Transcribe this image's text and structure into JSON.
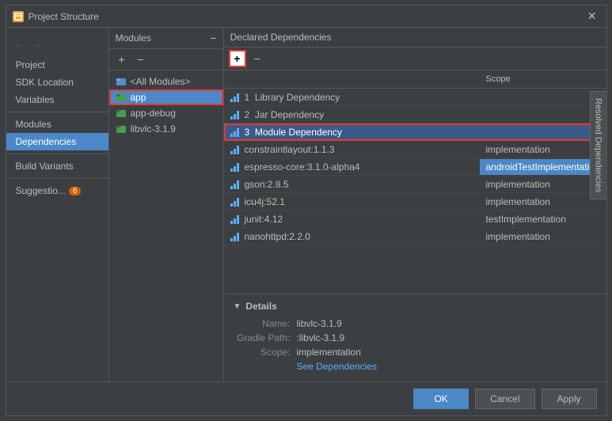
{
  "dialog": {
    "title": "Project Structure",
    "close_label": "✕"
  },
  "nav": {
    "back_arrow": "←",
    "forward_arrow": "→"
  },
  "sidebar": {
    "items": [
      {
        "id": "project",
        "label": "Project"
      },
      {
        "id": "sdk-location",
        "label": "SDK Location"
      },
      {
        "id": "variables",
        "label": "Variables"
      }
    ],
    "section2": [
      {
        "id": "modules",
        "label": "Modules"
      },
      {
        "id": "dependencies",
        "label": "Dependencies",
        "active": true
      }
    ],
    "section3": [
      {
        "id": "build-variants",
        "label": "Build Variants"
      }
    ],
    "suggestions": {
      "label": "Suggestio...",
      "count": "6"
    }
  },
  "modules_panel": {
    "title": "Modules",
    "minus_label": "−",
    "plus_label": "+",
    "modules": [
      {
        "id": "all-modules",
        "label": "<All Modules>",
        "icon": "all-modules-icon"
      },
      {
        "id": "app",
        "label": "app",
        "icon": "app-icon",
        "highlighted": true
      },
      {
        "id": "app-debug",
        "label": "app-debug",
        "icon": "app-debug-icon"
      },
      {
        "id": "libvlc",
        "label": "libvlc-3.1.9",
        "icon": "libvlc-icon"
      }
    ]
  },
  "deps_panel": {
    "title": "Declared Dependencies",
    "minus_label": "−",
    "plus_label": "+",
    "col_name": "",
    "col_scope": "Scope",
    "deps": [
      {
        "id": "lib-dep",
        "num": "1",
        "label": "Library Dependency",
        "scope": "",
        "selected": false,
        "highlighted": false
      },
      {
        "id": "jar-dep",
        "num": "2",
        "label": "Jar Dependency",
        "scope": "",
        "selected": false,
        "highlighted": false
      },
      {
        "id": "module-dep",
        "num": "3",
        "label": "Module Dependency",
        "scope": "",
        "selected": false,
        "highlighted": true
      },
      {
        "id": "constraintlayout",
        "num": "",
        "label": "constraintlayout:1.1.3",
        "scope": "implementation",
        "selected": false,
        "highlighted": false
      },
      {
        "id": "espresso",
        "num": "",
        "label": "espresso-core:3.1.0-alpha4",
        "scope": "androidTestImplementation",
        "selected": true,
        "highlighted": false
      },
      {
        "id": "gson",
        "num": "",
        "label": "gson:2.8.5",
        "scope": "implementation",
        "selected": false,
        "highlighted": false
      },
      {
        "id": "icu4j",
        "num": "",
        "label": "icu4j:52.1",
        "scope": "implementation",
        "selected": false,
        "highlighted": false
      },
      {
        "id": "junit",
        "num": "",
        "label": "junit:4.12",
        "scope": "testImplementation",
        "selected": false,
        "highlighted": false
      },
      {
        "id": "nanohttpd",
        "num": "",
        "label": "nanohttpd:2.2.0",
        "scope": "implementation",
        "selected": false,
        "highlighted": false
      }
    ]
  },
  "details": {
    "title": "Details",
    "name_label": "Name:",
    "name_value": "libvlc-3.1.9",
    "gradle_label": "Gradle Path:",
    "gradle_value": ":libvlc-3.1.9",
    "scope_label": "Scope:",
    "scope_value": "implementation",
    "link_label": "See Dependencies"
  },
  "right_edge_tab": "Resolved Dependencies",
  "buttons": {
    "ok": "OK",
    "cancel": "Cancel",
    "apply": "Apply"
  }
}
